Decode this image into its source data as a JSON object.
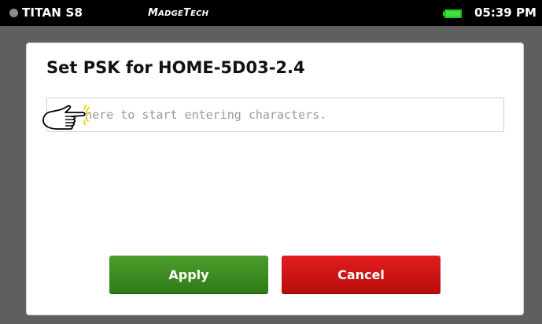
{
  "status_bar": {
    "device_name": "TITAN S8",
    "brand": "MadgeTech",
    "battery_icon": "battery-full-icon",
    "battery_color": "#21c321",
    "time": "05:39 PM"
  },
  "dialog": {
    "title": "Set PSK for HOME-5D03-2.4",
    "psk_input": {
      "value": "",
      "placeholder": "Tap here to start entering characters."
    },
    "tap_hint_icon": "pointing-hand-icon",
    "apply_label": "Apply",
    "cancel_label": "Cancel",
    "apply_color": "#3a8b20",
    "cancel_color": "#d01414"
  }
}
